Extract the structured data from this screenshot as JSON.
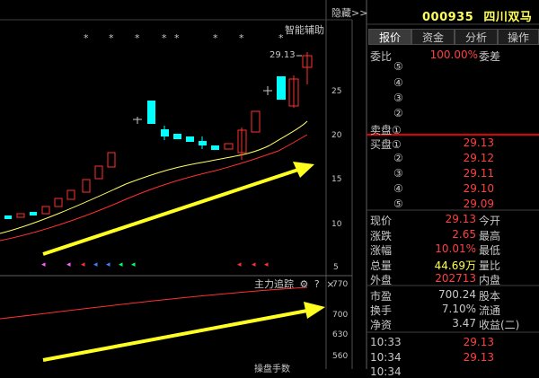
{
  "header": {
    "hide_label": "隐藏>>",
    "stock_code": "000935",
    "stock_name": "四川双马"
  },
  "tabs": [
    {
      "label": "报价",
      "active": true
    },
    {
      "label": "资金",
      "active": false
    },
    {
      "label": "分析",
      "active": false
    },
    {
      "label": "操作",
      "active": false
    }
  ],
  "chart": {
    "smart_assist_label": "智能辅助",
    "price_label": "29.13",
    "stars": [
      "*",
      "*",
      "*",
      "*",
      "*",
      "*",
      "*",
      "*"
    ],
    "price_axis_ticks": [
      "25",
      "20",
      "15",
      "10",
      "5"
    ],
    "indicator_title": "主力追踪",
    "indicator_gear_icon": "gear-icon",
    "indicator_help": "?",
    "indicator_close": "×",
    "indicator_axis_ticks": [
      "770",
      "700",
      "630",
      "560"
    ],
    "bottom_cut_label": "操盘手数"
  },
  "order_book": {
    "wei_bi_label": "委比",
    "wei_bi_value": "100.00%",
    "wei_cha_label": "委差",
    "sell_levels": [
      "⑤",
      "④",
      "③",
      "②",
      "卖盘①"
    ],
    "buy_levels": [
      {
        "label": "买盘①",
        "price": "29.13"
      },
      {
        "label": "②",
        "price": "29.12"
      },
      {
        "label": "③",
        "price": "29.11"
      },
      {
        "label": "④",
        "price": "29.10"
      },
      {
        "label": "⑤",
        "price": "29.09"
      }
    ]
  },
  "quote": [
    {
      "l1": "现价",
      "v1": "29.13",
      "l2": "今开",
      "c": "red"
    },
    {
      "l1": "涨跌",
      "v1": "2.65",
      "l2": "最高",
      "c": "red"
    },
    {
      "l1": "涨幅",
      "v1": "10.01%",
      "l2": "最低",
      "c": "red"
    },
    {
      "l1": "总量",
      "v1": "44.69万",
      "l2": "量比",
      "c": "yel"
    },
    {
      "l1": "外盘",
      "v1": "202713",
      "l2": "内盘",
      "c": "red"
    }
  ],
  "fundamentals": [
    {
      "l1": "市盈",
      "v1": "700.24",
      "l2": "股本"
    },
    {
      "l1": "换手",
      "v1": "7.10%",
      "l2": "流通"
    },
    {
      "l1": "净资",
      "v1": "3.47",
      "l2": "收益(二)"
    }
  ],
  "ticks": [
    {
      "time": "10:33",
      "price": "29.13"
    },
    {
      "time": "10:34",
      "price": "29.13"
    },
    {
      "time": "10:34",
      "price": ""
    }
  ],
  "colors": {
    "up": "#ff3030",
    "down": "#00ffff",
    "ma_yellow": "#ffff60",
    "ma_red": "#ff3030",
    "arrow": "#ffff20"
  }
}
